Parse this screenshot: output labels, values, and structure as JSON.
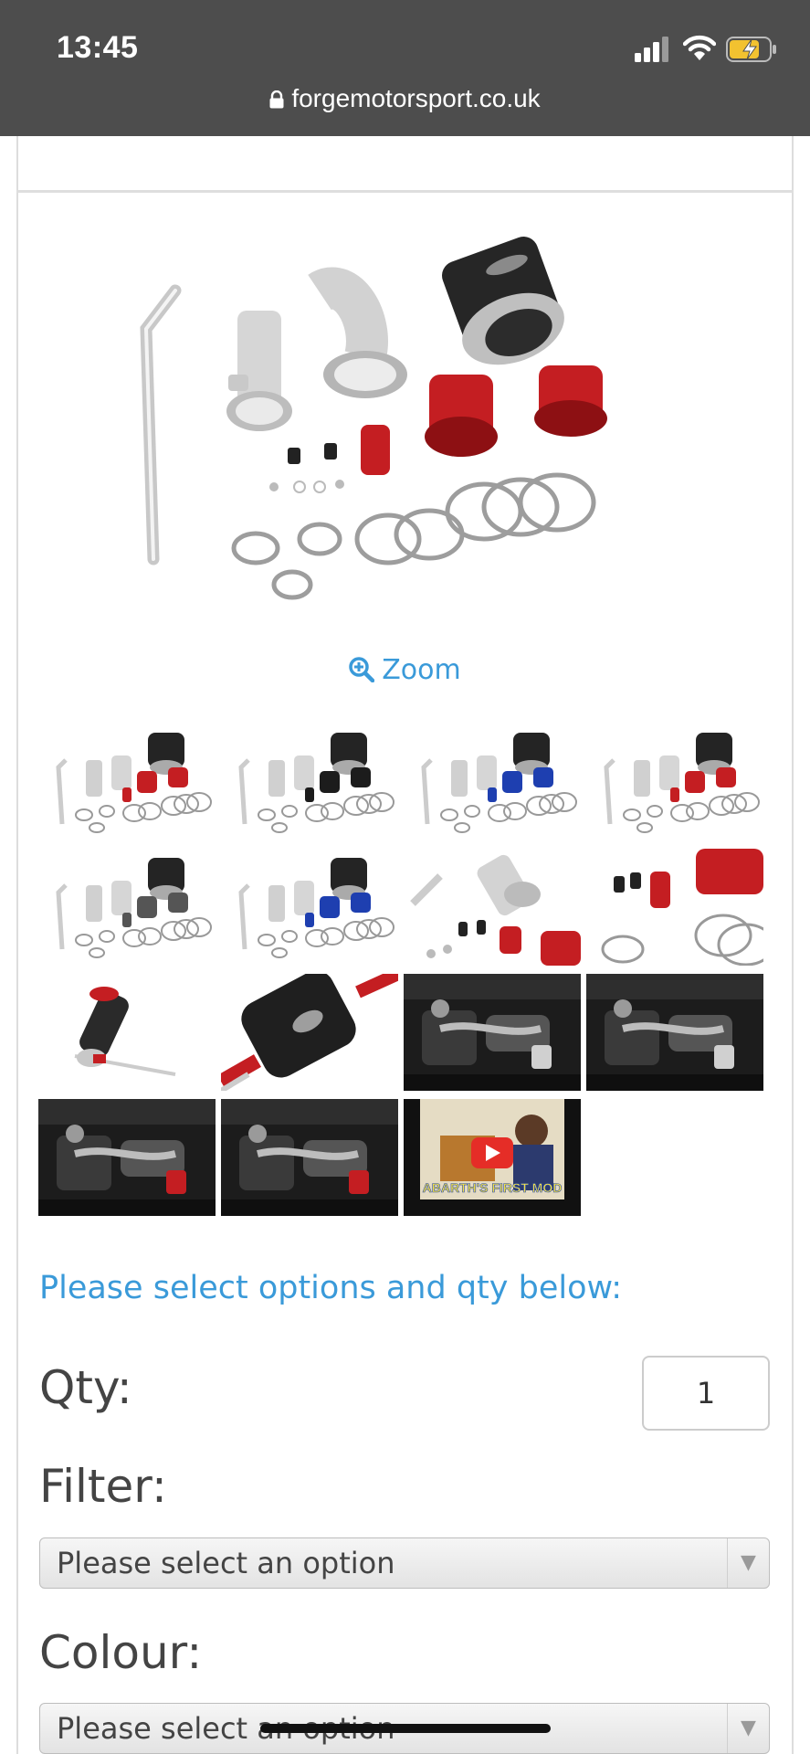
{
  "status_bar": {
    "time": "13:45"
  },
  "browser": {
    "url": "forgemotorsport.co.uk"
  },
  "product": {
    "zoom_label": "Zoom",
    "thumbnails": [
      {
        "kind": "kit",
        "accent": "#c41e22"
      },
      {
        "kind": "kit",
        "accent": "#1c1c1c"
      },
      {
        "kind": "kit",
        "accent": "#1e3fb0"
      },
      {
        "kind": "kit",
        "accent": "#c41e22"
      },
      {
        "kind": "kit",
        "accent": "#555555"
      },
      {
        "kind": "kit",
        "accent": "#1e3fb0"
      },
      {
        "kind": "closeup-pipe",
        "accent": "#c41e22"
      },
      {
        "kind": "closeup-hose",
        "accent": "#c41e22"
      },
      {
        "kind": "assembled",
        "accent": "#c41e22"
      },
      {
        "kind": "assembled-large",
        "accent": "#c41e22"
      },
      {
        "kind": "engine-bay",
        "accent": "#d0d0d0"
      },
      {
        "kind": "engine-bay",
        "accent": "#d0d0d0"
      },
      {
        "kind": "engine-bay",
        "accent": "#c41e22"
      },
      {
        "kind": "engine-bay",
        "accent": "#c41e22"
      },
      {
        "kind": "video",
        "accent": "#e52d27",
        "caption": "ABARTH'S FIRST MOD"
      }
    ]
  },
  "options": {
    "prompt": "Please select options and qty below:",
    "qty_label": "Qty:",
    "qty_value": "1",
    "filter_label": "Filter:",
    "filter_placeholder": "Please select an option",
    "colour_label": "Colour:",
    "colour_placeholder": "Please select an option"
  },
  "colors": {
    "link": "#3a9ad9",
    "status_bar": "#4d4d4d",
    "battery": "#f2c230"
  }
}
